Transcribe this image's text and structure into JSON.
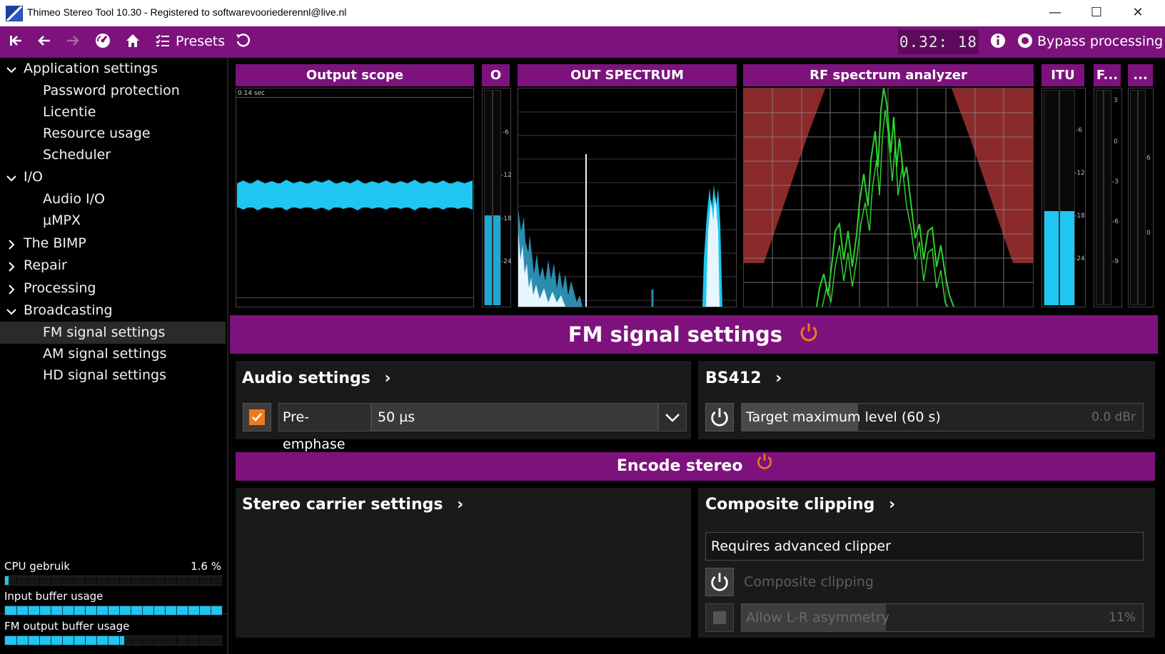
{
  "window": {
    "title": "Thimeo Stereo Tool 10.30 - Registered to softwarevooriederennl@live.nl",
    "minimize": "—",
    "maximize": "☐",
    "close": "✕"
  },
  "toolbar": {
    "presets_label": "Presets",
    "clock": "0.32: 18",
    "bypass_label": "Bypass processing",
    "icons": [
      "skip-start-icon",
      "back-arrow-icon",
      "forward-arrow-icon",
      "dashboard-icon",
      "home-icon",
      "presets-list-icon",
      "undo-icon",
      "info-icon",
      "bypass-power-icon"
    ]
  },
  "sidebar": {
    "items": [
      {
        "label": "Application settings",
        "chevron": "down",
        "level": 0
      },
      {
        "label": "Password protection",
        "level": 1
      },
      {
        "label": "Licentie",
        "level": 1
      },
      {
        "label": "Resource usage",
        "level": 1
      },
      {
        "label": "Scheduler",
        "level": 1
      },
      {
        "label": "I/O",
        "chevron": "down",
        "level": 0
      },
      {
        "label": "Audio I/O",
        "level": 1
      },
      {
        "label": "µMPX",
        "level": 1
      },
      {
        "label": "The BIMP",
        "chevron": "right",
        "level": 0
      },
      {
        "label": "Repair",
        "chevron": "right",
        "level": 0
      },
      {
        "label": "Processing",
        "chevron": "right",
        "level": 0
      },
      {
        "label": "Broadcasting",
        "chevron": "down",
        "level": 0
      },
      {
        "label": "FM signal settings",
        "level": 1,
        "active": true
      },
      {
        "label": "AM signal settings",
        "level": 1
      },
      {
        "label": "HD signal settings",
        "level": 1
      }
    ],
    "meters": [
      {
        "label": "CPU gebruik",
        "value": "1.6 %",
        "fill": 0.016
      },
      {
        "label": "Input buffer usage",
        "value": "",
        "fill": 1.0
      },
      {
        "label": "FM output buffer usage",
        "value": "",
        "fill": 0.55
      }
    ]
  },
  "panels": {
    "output_scope": {
      "title": "Output scope",
      "time_label": "0.14 sec"
    },
    "o_meter": {
      "title": "O",
      "ticks": [
        "-6",
        "-12",
        "-18",
        "-24"
      ],
      "level": 0.42
    },
    "out_spectrum": {
      "title": "OUT SPECTRUM"
    },
    "rf_spectrum": {
      "title": "RF spectrum analyzer"
    },
    "itu_meter": {
      "title": "ITU",
      "ticks": [
        "-6",
        "-12",
        "-18",
        "-24"
      ],
      "level": 0.44
    },
    "f_meter": {
      "title": "F...",
      "ticks": [
        "3",
        "0",
        "-3",
        "-6",
        "-9"
      ]
    },
    "more_meter": {
      "title": "...",
      "ticks": [
        "6",
        "0"
      ]
    }
  },
  "fm_signal": {
    "title": "FM signal settings",
    "audio_settings": {
      "title": "Audio settings",
      "pre_emphase_label": "Pre-emphase",
      "pre_emphase_value": "50 µs",
      "pre_emphase_checked": true
    },
    "bs412": {
      "title": "BS412",
      "target_label": "Target maximum level (60 s)",
      "target_value": "0.0 dBr",
      "target_fill": 0.29
    }
  },
  "encode_stereo": {
    "title": "Encode stereo",
    "stereo_carrier": {
      "title": "Stereo carrier settings"
    },
    "composite_clipping": {
      "title": "Composite clipping",
      "requires_text": "Requires advanced clipper",
      "clipping_label": "Composite clipping",
      "asymmetry_label": "Allow L-R asymmetry",
      "asymmetry_value": "11%",
      "asymmetry_fill": 0.36
    }
  },
  "colors": {
    "accent": "#7d127d",
    "cyan": "#1fc6f1",
    "power_orange": "#f07a1a",
    "rf_red": "#8a2a2a",
    "rf_green": "#2fd12f"
  }
}
